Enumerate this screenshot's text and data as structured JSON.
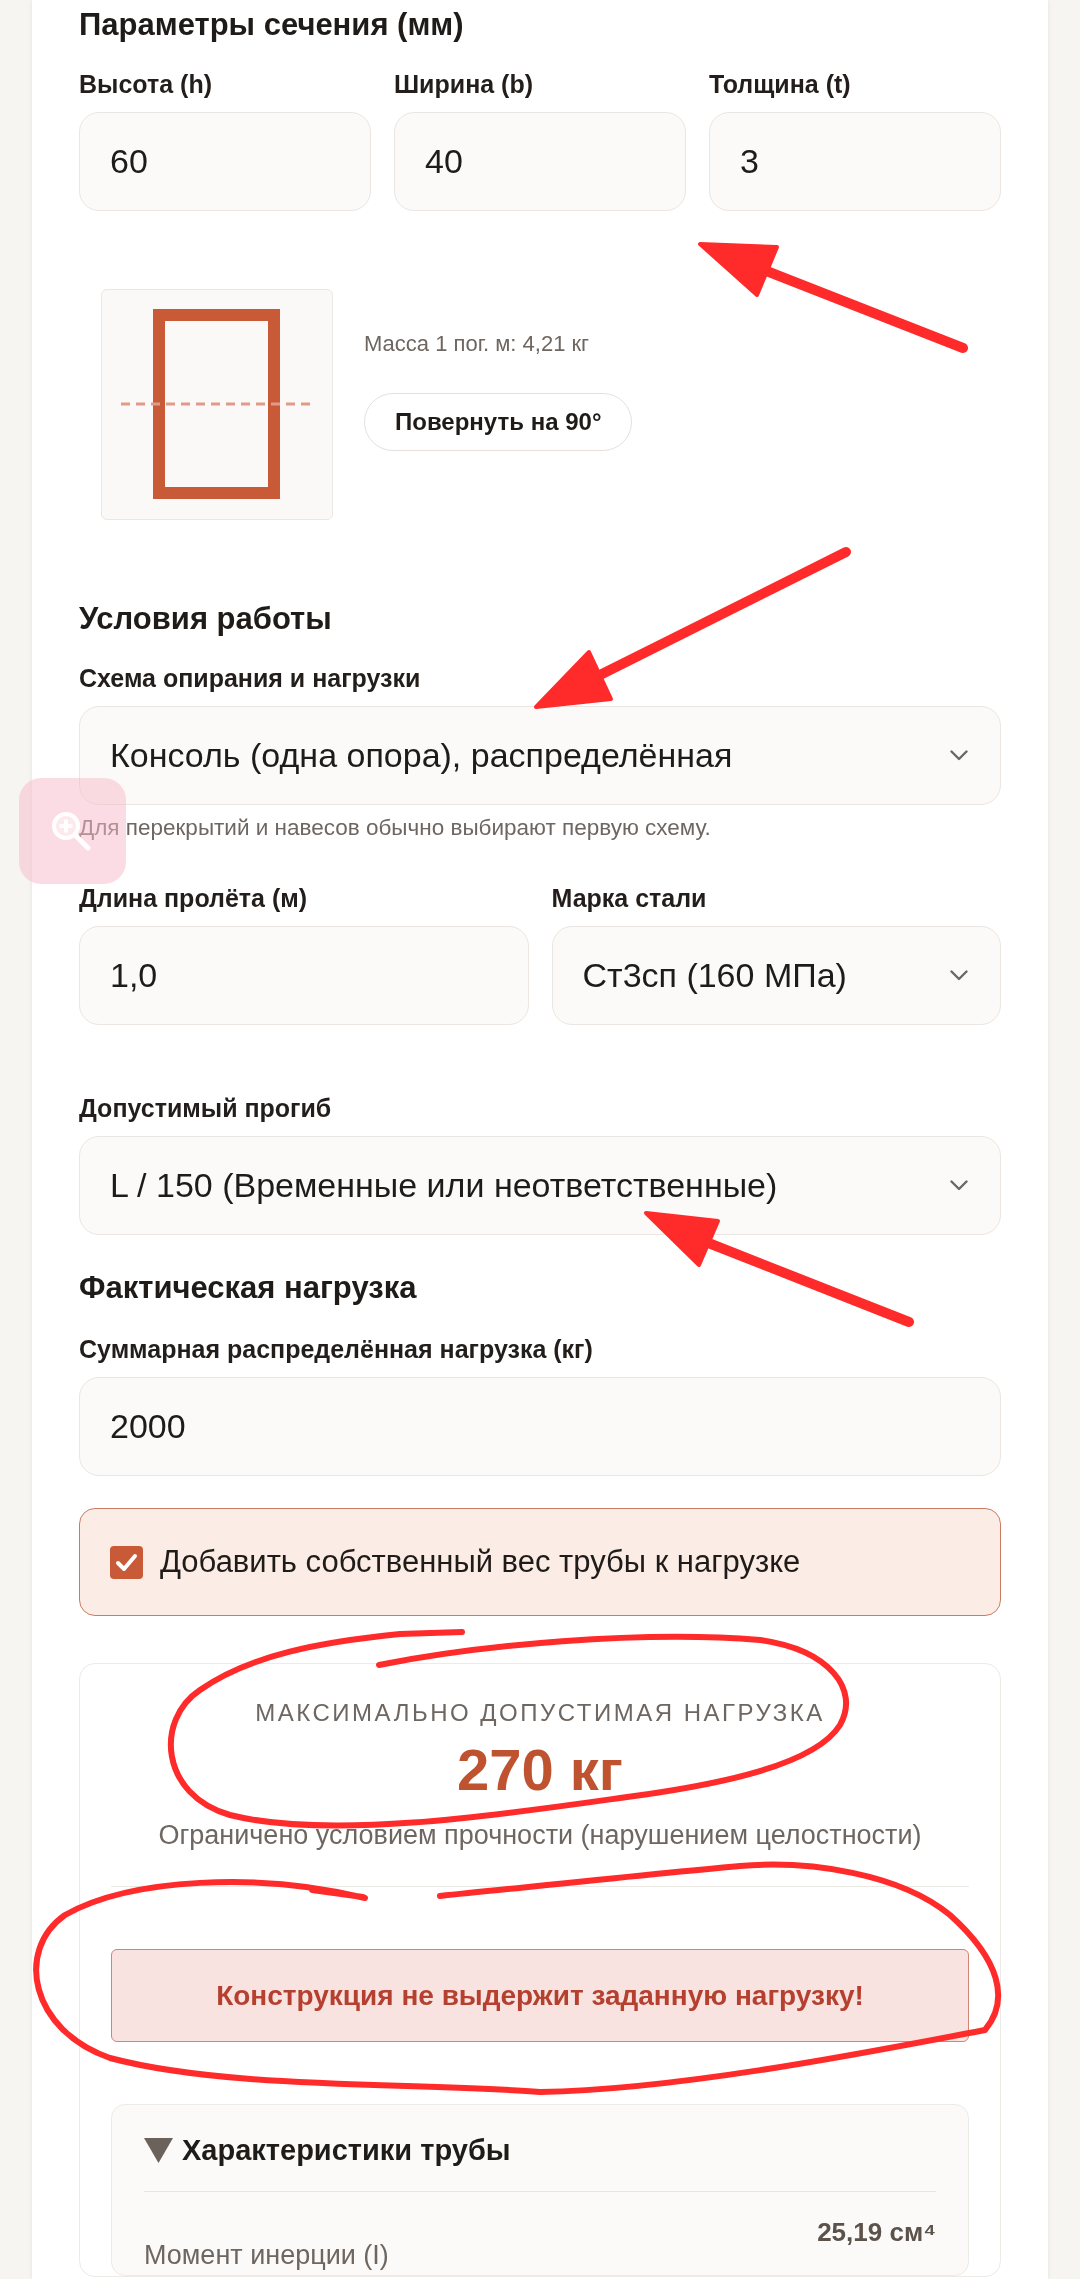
{
  "section": {
    "title": "Параметры сечения (мм)",
    "fields": [
      {
        "kind": "input",
        "label": "Высота (h)",
        "value": "60"
      },
      {
        "kind": "input",
        "label": "Ширина (b)",
        "value": "40"
      },
      {
        "kind": "input",
        "label": "Толщина (t)",
        "value": "3"
      }
    ]
  },
  "profile": {
    "mass": "Масса 1 пог. м: 4,21 кг",
    "rotate_button": "Повернуть на 90°"
  },
  "conditions": {
    "title": "Условия работы",
    "scheme": {
      "kind": "select",
      "label": "Схема опирания и нагрузки",
      "value": "Консоль (одна опора), распределённая",
      "hint": "Для перекрытий и навесов обычно выбирают первую схему."
    },
    "fields": [
      {
        "kind": "input",
        "label": "Длина пролёта (м)",
        "value": "1,0"
      },
      {
        "kind": "select",
        "label": "Марка стали",
        "value": "Ст3сп (160 МПа)"
      }
    ],
    "deflection": {
      "kind": "select",
      "label": "Допустимый прогиб",
      "value": "L / 150 (Временные или неответственные)"
    }
  },
  "load": {
    "title": "Фактическая нагрузка",
    "field": {
      "kind": "input",
      "label": "Суммарная распределённая нагрузка (кг)",
      "value": "2000"
    },
    "self_weight": {
      "label": "Добавить собственный вес трубы к нагрузке",
      "checked": true
    }
  },
  "result": {
    "caption": "МАКСИМАЛЬНО ДОПУСТИМАЯ НАГРУЗКА",
    "value": "270 кг",
    "note": "Ограничено условием прочности (нарушением целостности)",
    "alert": "Конструкция не выдержит заданную нагрузку!",
    "details": {
      "title": "Характеристики трубы",
      "expanded": true,
      "rows": [
        {
          "label": "Момент инерции (I)",
          "value": "25,19 см⁴"
        }
      ]
    }
  }
}
